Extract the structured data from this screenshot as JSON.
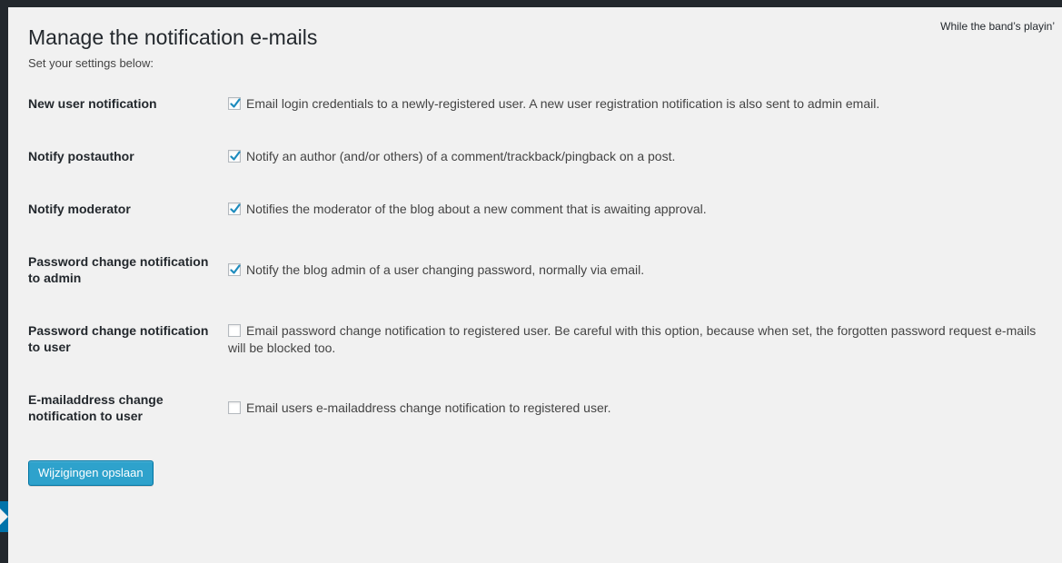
{
  "header": {
    "title": "Manage the notification e-mails",
    "subtitle": "Set your settings below:",
    "top_right_text": "While the band’s playin’"
  },
  "settings": [
    {
      "label": "New user notification",
      "description": "Email login credentials to a newly-registered user. A new user registration notification is also sent to admin email.",
      "checked": true
    },
    {
      "label": "Notify postauthor",
      "description": "Notify an author (and/or others) of a comment/trackback/pingback on a post.",
      "checked": true
    },
    {
      "label": "Notify moderator",
      "description": "Notifies the moderator of the blog about a new comment that is awaiting approval.",
      "checked": true
    },
    {
      "label": "Password change notification to admin",
      "description": "Notify the blog admin of a user changing password, normally via email.",
      "checked": true
    },
    {
      "label": "Password change notification to user",
      "description": "Email password change notification to registered user. Be careful with this option, because when set, the forgotten password request e-mails will be blocked too.",
      "checked": false
    },
    {
      "label": "E-mailaddress change notification to user",
      "description": "Email users e-mailaddress change notification to registered user.",
      "checked": false
    }
  ],
  "actions": {
    "save_label": "Wijzigingen opslaan"
  },
  "colors": {
    "admin_bar": "#23282d",
    "content_bg": "#f1f1f1",
    "primary_button": "#2ea2cc",
    "checkmark": "#1e8cbe"
  }
}
